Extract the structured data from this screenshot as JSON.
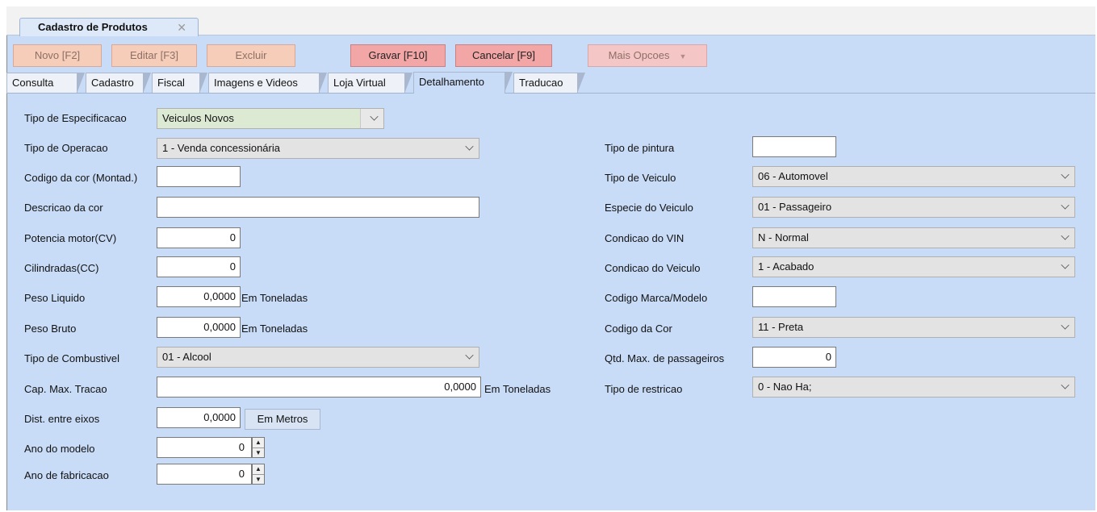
{
  "document_tab": {
    "title": "Cadastro de Produtos",
    "close_symbol": "✕"
  },
  "toolbar": {
    "novo": "Novo [F2]",
    "editar": "Editar [F3]",
    "excluir": "Excluir",
    "gravar": "Gravar [F10]",
    "cancelar": "Cancelar [F9]",
    "mais_opcoes": "Mais Opcoes"
  },
  "tabs": [
    "Consulta",
    "Cadastro",
    "Fiscal",
    "Imagens e Videos",
    "Loja Virtual",
    "Detalhamento",
    "Traducao"
  ],
  "active_tab": "Detalhamento",
  "left": {
    "tipo_especificacao": {
      "label": "Tipo de Especificacao",
      "value": "Veiculos Novos"
    },
    "tipo_operacao": {
      "label": "Tipo de Operacao",
      "value": "1 - Venda concessionária"
    },
    "codigo_cor": {
      "label": "Codigo da cor (Montad.)",
      "value": ""
    },
    "descricao_cor": {
      "label": "Descricao da cor",
      "value": ""
    },
    "potencia": {
      "label": "Potencia motor(CV)",
      "value": "0"
    },
    "cilindradas": {
      "label": "Cilindradas(CC)",
      "value": "0"
    },
    "peso_liquido": {
      "label": "Peso Liquido",
      "value": "0,0000",
      "unit": "Em Toneladas"
    },
    "peso_bruto": {
      "label": "Peso Bruto",
      "value": "0,0000",
      "unit": "Em Toneladas"
    },
    "combustivel": {
      "label": "Tipo de Combustivel",
      "value": "01 - Alcool"
    },
    "cap_tracao": {
      "label": "Cap. Max. Tracao",
      "value": "0,0000",
      "unit": "Em Toneladas"
    },
    "dist_eixos": {
      "label": "Dist. entre eixos",
      "value": "0,0000",
      "unit": "Em Metros"
    },
    "ano_modelo": {
      "label": "Ano do modelo",
      "value": "0"
    },
    "ano_fabricacao": {
      "label": "Ano de fabricacao",
      "value": "0"
    }
  },
  "right": {
    "tipo_pintura": {
      "label": "Tipo de pintura",
      "value": ""
    },
    "tipo_veiculo": {
      "label": "Tipo de Veiculo",
      "value": "06 - Automovel"
    },
    "especie": {
      "label": "Especie do Veiculo",
      "value": "01 - Passageiro"
    },
    "condicao_vin": {
      "label": "Condicao do VIN",
      "value": "N - Normal"
    },
    "condicao_veiculo": {
      "label": "Condicao do Veiculo",
      "value": "1 - Acabado"
    },
    "marca_modelo": {
      "label": "Codigo Marca/Modelo",
      "value": ""
    },
    "codigo_cor": {
      "label": "Codigo da Cor",
      "value": "11 - Preta"
    },
    "qtd_passageiros": {
      "label": "Qtd. Max. de passageiros",
      "value": "0"
    },
    "restricao": {
      "label": "Tipo de restricao",
      "value": "0 - Nao Ha;"
    }
  },
  "colors": {
    "panel": "#c9dcf7",
    "button_disabled": "#f6cdb9",
    "button_active": "#f3a6a6"
  }
}
